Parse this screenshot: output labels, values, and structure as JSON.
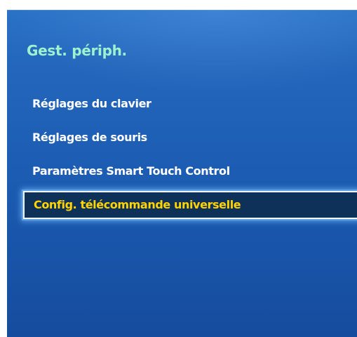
{
  "panel": {
    "title": "Gest. périph."
  },
  "menu": {
    "items": [
      {
        "label": "Réglages du clavier",
        "selected": false
      },
      {
        "label": "Réglages de souris",
        "selected": false
      },
      {
        "label": "Paramètres Smart Touch Control",
        "selected": false
      },
      {
        "label": "Config. télécommande universelle",
        "selected": true
      }
    ]
  },
  "colors": {
    "panel_background": "#1d5eb4",
    "title_color": "#9ff2ce",
    "item_color": "#ffffff",
    "selected_item_color": "#ffd400",
    "selected_background": "#0d3159",
    "selected_border": "#f4f7fb"
  }
}
